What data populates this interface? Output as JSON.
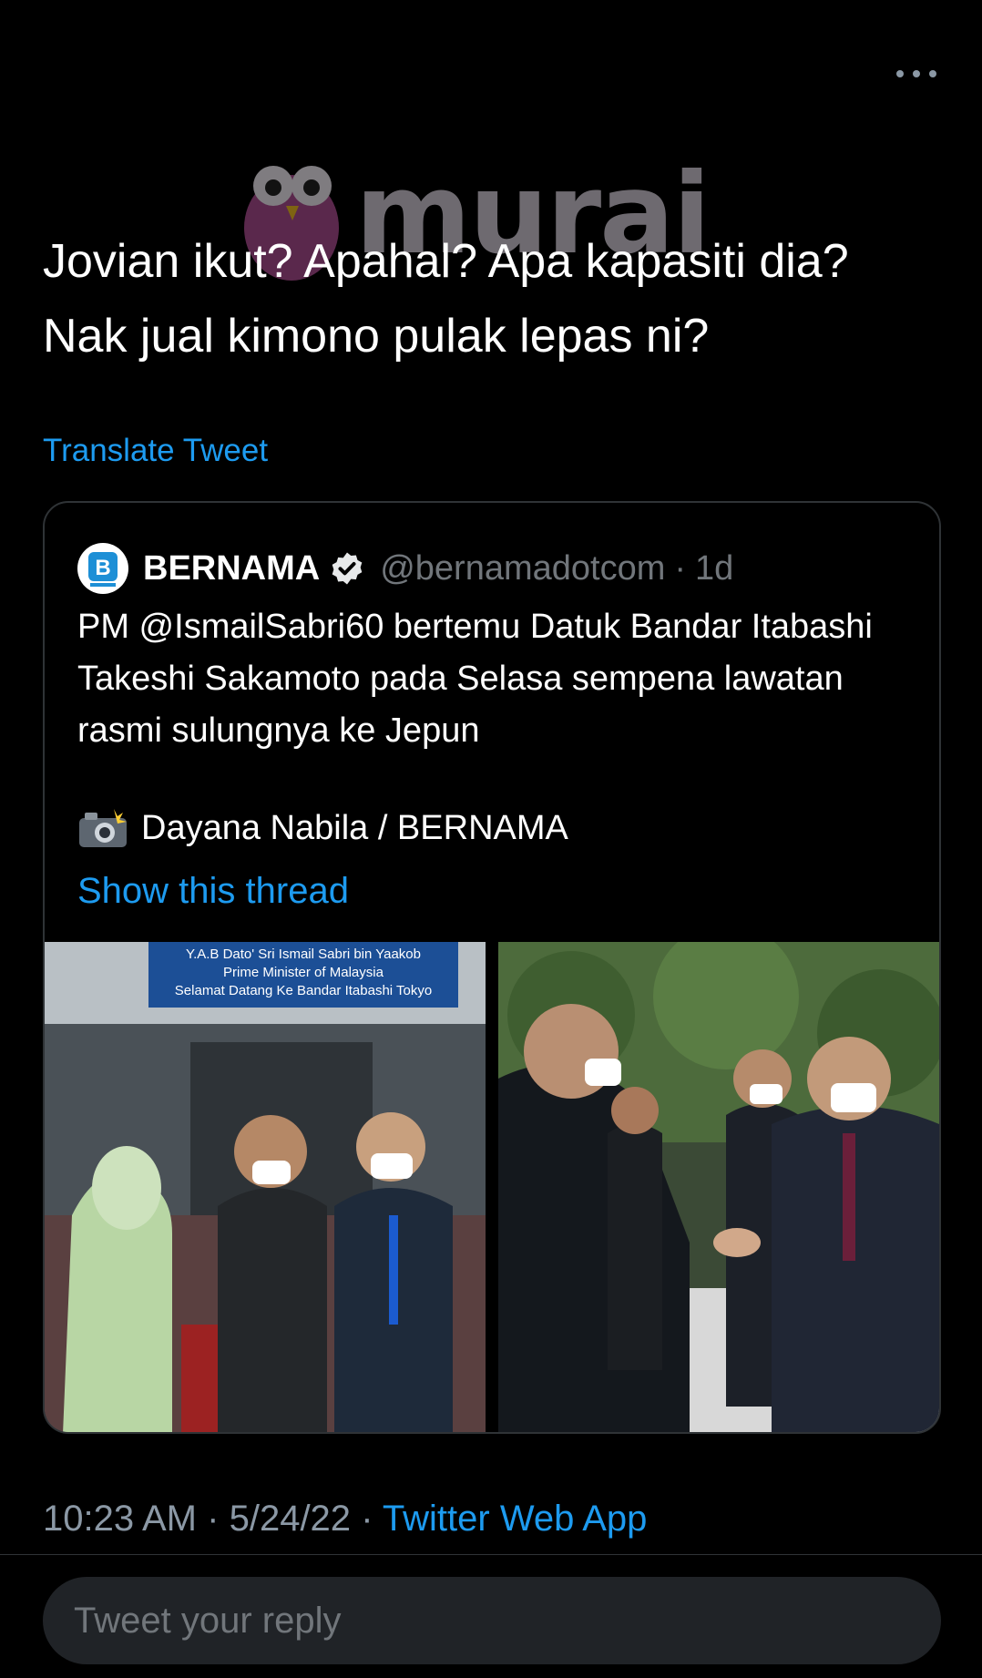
{
  "watermark": {
    "brand": "murai"
  },
  "tweet": {
    "text": "Jovian ikut? Apahal? Apa kapasiti dia? Nak jual kimono pulak lepas ni?",
    "translate_label": "Translate Tweet"
  },
  "quote": {
    "name": "BERNAMA",
    "handle": "@bernamadotcom",
    "separator": "·",
    "time": "1d",
    "text": "PM @IsmailSabri60 bertemu Datuk Bandar Itabashi Takeshi Sakamoto pada Selasa sempena lawatan rasmi sulungnya ke Jepun",
    "photo_credit": "Dayana Nabila / BERNAMA",
    "show_thread_label": "Show this thread",
    "sign": {
      "line1": "Y.A.B Dato' Sri Ismail Sabri bin Yaakob",
      "line2": "Prime Minister of Malaysia",
      "line3": "Selamat Datang Ke Bandar Itabashi Tokyo"
    }
  },
  "meta": {
    "time": "10:23 AM",
    "sep1": "·",
    "date": "5/24/22",
    "sep2": "·",
    "source": "Twitter Web App"
  },
  "reply": {
    "placeholder": "Tweet your reply"
  },
  "colors": {
    "background": "#000000",
    "link": "#1d9bf0",
    "muted": "#71767b",
    "reply_bg": "#202327"
  }
}
